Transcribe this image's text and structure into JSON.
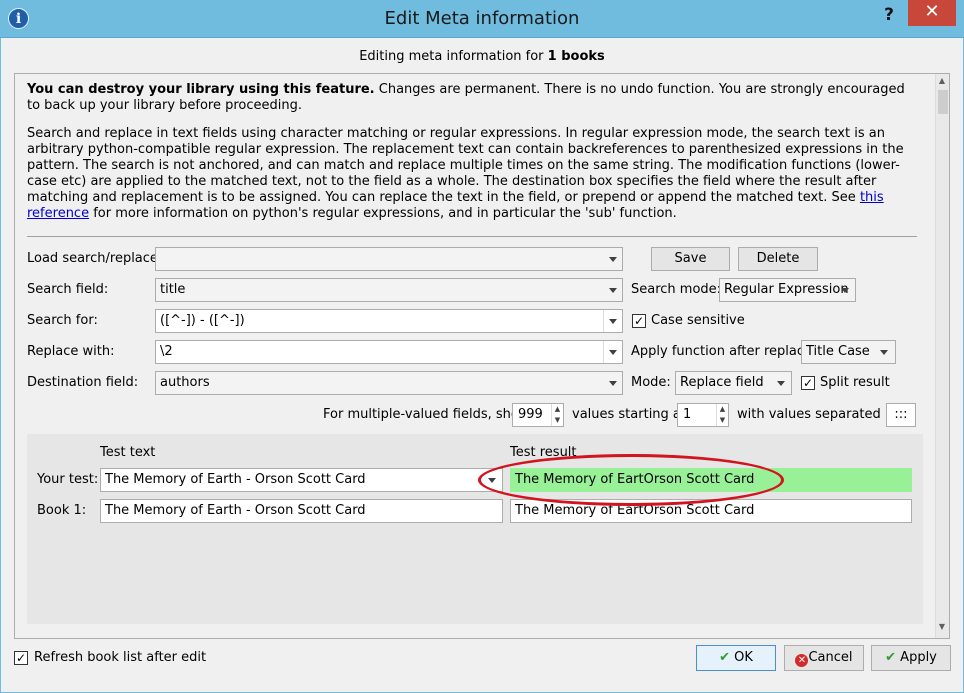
{
  "window": {
    "title": "Edit Meta information",
    "help_glyph": "?",
    "close_glyph": "✕"
  },
  "header": {
    "subtitle_prefix": "Editing meta information for ",
    "subtitle_count": "1 books"
  },
  "warning": {
    "bold": "You can destroy your library using this feature.",
    "rest": " Changes are permanent. There is no undo function. You are strongly encouraged to back up your library before proceeding."
  },
  "description": {
    "text": "Search and replace in text fields using character matching or regular expressions. In regular expression mode, the search text is an arbitrary python-compatible regular expression. The replacement text can contain backreferences to parenthesized expressions in the pattern. The search is not anchored, and can match and replace multiple times on the same string. The modification functions (lower-case etc) are applied to the matched text, not to the field as a whole. The destination box specifies the field where the result after matching and replacement is to be assigned. You can replace the text in the field, or prepend or append the matched text. See ",
    "link": "this reference",
    "tail": " for more information on python's regular expressions, and in particular the 'sub' function."
  },
  "form": {
    "load_label": "Load search/replace:",
    "load_value": "",
    "save_button": "Save",
    "delete_button": "Delete",
    "search_field_label": "Search field:",
    "search_field_value": "title",
    "search_mode_label": "Search mode:",
    "search_mode_value": "Regular Expression",
    "search_for_label": "Search for:",
    "search_for_value": "([^-]) - ([^-])",
    "case_sensitive_label": "Case sensitive",
    "case_sensitive_checked": true,
    "replace_with_label": "Replace with:",
    "replace_with_value": "\\2",
    "apply_function_label": "Apply function after replace:",
    "apply_function_value": "Title Case",
    "destination_label": "Destination field:",
    "destination_value": "authors",
    "mode_label": "Mode:",
    "mode_value": "Replace field",
    "split_result_label": "Split result",
    "split_result_checked": true,
    "multi_prefix": "For multiple-valued fields, show",
    "multi_show_value": "999",
    "multi_middle": "values starting at",
    "multi_start_value": "1",
    "multi_suffix": "with values separated by",
    "multi_separator": ":::"
  },
  "test": {
    "col_test_text": "Test text",
    "col_test_result": "Test result",
    "your_test_label": "Your test:",
    "your_test_text": "The Memory of Earth - Orson Scott Card",
    "your_test_result": "The Memory of EartOrson Scott Card",
    "book1_label": "Book 1:",
    "book1_text": "The Memory of Earth - Orson Scott Card",
    "book1_result": "The Memory of EartOrson Scott Card"
  },
  "footer": {
    "refresh_label": "Refresh book list after edit",
    "refresh_checked": true,
    "ok_button": "OK",
    "cancel_button": "Cancel",
    "apply_button": "Apply"
  },
  "colors": {
    "titlebar": "#6fbcdf",
    "close": "#c7473a",
    "result_highlight": "#98f097",
    "annotation": "#d2141e"
  }
}
